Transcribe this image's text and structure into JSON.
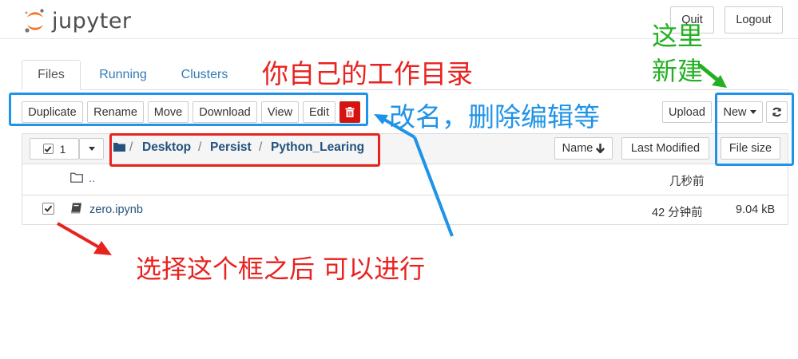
{
  "header": {
    "app_name": "Jupyter",
    "logo_text": "jupyter",
    "quit_label": "Quit",
    "logout_label": "Logout"
  },
  "tabs": [
    {
      "label": "Files",
      "active": true
    },
    {
      "label": "Running",
      "active": false
    },
    {
      "label": "Clusters",
      "active": false
    }
  ],
  "toolbar": {
    "duplicate_label": "Duplicate",
    "rename_label": "Rename",
    "move_label": "Move",
    "download_label": "Download",
    "view_label": "View",
    "edit_label": "Edit",
    "delete_icon": "trash-icon",
    "upload_label": "Upload",
    "new_label": "New",
    "refresh_icon": "refresh-icon"
  },
  "list_header": {
    "selected_count": "1",
    "checkbox_checked": true,
    "breadcrumb": [
      "Desktop",
      "Persist",
      "Python_Learing"
    ],
    "separator": "/",
    "sort_name_label": "Name",
    "last_modified_label": "Last Modified",
    "file_size_label": "File size"
  },
  "rows": [
    {
      "name": "..",
      "icon": "folder-icon",
      "modified": "几秒前",
      "size": "",
      "checked": false
    },
    {
      "name": "zero.ipynb",
      "icon": "notebook-icon",
      "modified": "42 分钟前",
      "size": "9.04 kB",
      "checked": true
    }
  ],
  "annotations": {
    "work_dir": "你自己的工作目录",
    "rename_delete": "改名，删除编辑等",
    "new_here_line1": "这里",
    "new_here_line2": "新建",
    "select_box": "选择这个框之后 可以进行"
  },
  "colors": {
    "annotation_red": "#e8221f",
    "annotation_blue": "#1f93e8",
    "annotation_green": "#22b022",
    "link_blue": "#337ab7",
    "danger_red": "#d9120f"
  }
}
